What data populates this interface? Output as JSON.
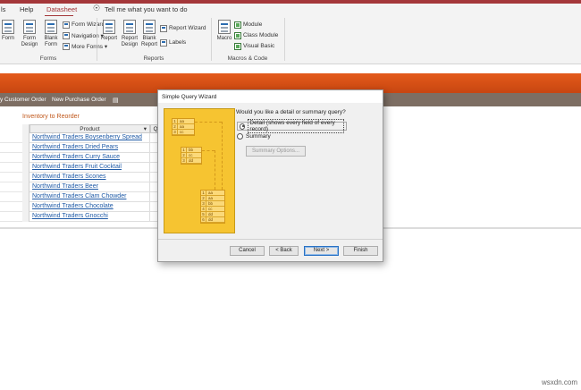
{
  "menubar": {
    "items": [
      "ls",
      "Help",
      "Datasheet"
    ],
    "search": "Tell me what you want to do"
  },
  "ribbon": {
    "forms": {
      "label": "Forms",
      "big": [
        "Form",
        "Form Design",
        "Blank Form"
      ],
      "small": [
        "Form Wizard",
        "Navigation ▾",
        "More Forms ▾"
      ]
    },
    "reports": {
      "label": "Reports",
      "big": [
        "Report",
        "Report Design",
        "Blank Report"
      ],
      "small": [
        "Report Wizard",
        "Labels"
      ]
    },
    "macros": {
      "label": "Macros & Code",
      "big": [
        "Macro"
      ],
      "small": [
        "Module",
        "Class Module",
        "Visual Basic"
      ]
    }
  },
  "strip": {
    "items": [
      "y Customer Order",
      "New Purchase Order"
    ]
  },
  "inventory": {
    "heading": "Inventory to Reorder",
    "column": "Product",
    "column2": "Q",
    "rows": [
      "Northwind Traders Boysenberry Spread",
      "Northwind Traders Dried Pears",
      "Northwind Traders Curry Sauce",
      "Northwind Traders Fruit Cocktail",
      "Northwind Traders Scones",
      "Northwind Traders Beer",
      "Northwind Traders Clam Chowder",
      "Northwind Traders Chocolate",
      "Northwind Traders Gnocchi"
    ]
  },
  "dialog": {
    "title": "Simple Query Wizard",
    "question": "Would you like a detail or summary query?",
    "detail": "Detail (shows every field of every record)",
    "summary": "Summary",
    "summary_options": "Summary Options...",
    "buttons": {
      "cancel": "Cancel",
      "back": "< Back",
      "next": "Next >",
      "finish": "Finish"
    },
    "art": {
      "table1": [
        [
          "1",
          "aa"
        ],
        [
          "2",
          "aa"
        ],
        [
          "3",
          "cc"
        ]
      ],
      "table2": [
        [
          "1",
          "bb"
        ],
        [
          "2",
          "cc"
        ],
        [
          "3",
          "dd"
        ]
      ],
      "table3": [
        [
          "1",
          "aa"
        ],
        [
          "2",
          "aa"
        ],
        [
          "3",
          "bb"
        ],
        [
          "4",
          "cc"
        ],
        [
          "5",
          "dd"
        ],
        [
          "6",
          "dd"
        ]
      ]
    }
  },
  "watermark": "wsxdn.com"
}
